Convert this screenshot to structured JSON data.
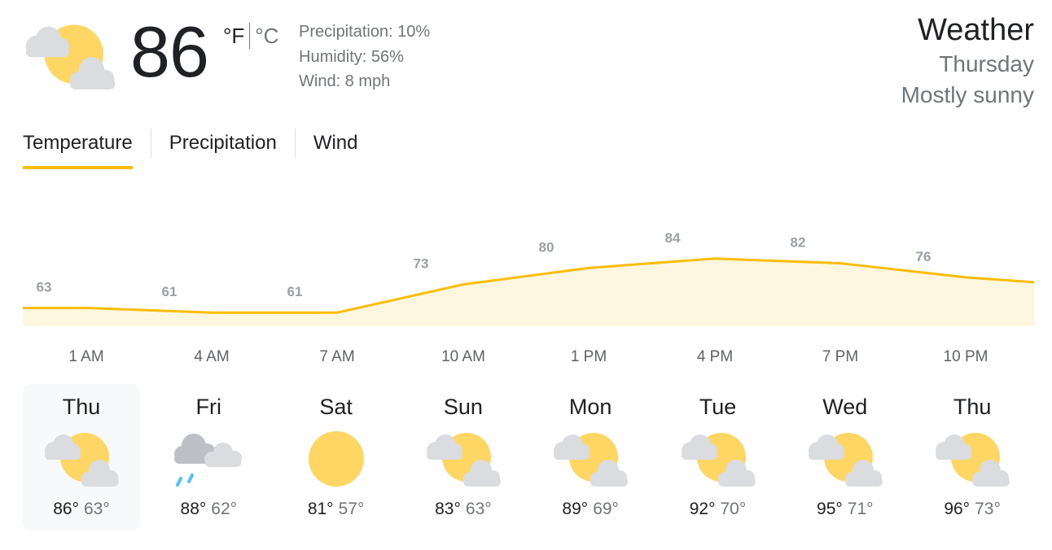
{
  "current": {
    "temperature": "86",
    "unit_f": "°F",
    "unit_c": "°C",
    "icon": "partly-cloudy-icon",
    "precipitation": "Precipitation: 10%",
    "humidity": "Humidity: 56%",
    "wind": "Wind: 8 mph"
  },
  "header": {
    "title": "Weather",
    "day": "Thursday",
    "condition": "Mostly sunny"
  },
  "tabs": [
    {
      "label": "Temperature",
      "active": true
    },
    {
      "label": "Precipitation",
      "active": false
    },
    {
      "label": "Wind",
      "active": false
    }
  ],
  "colors": {
    "accent": "#fbbc04",
    "line": "#fbbc04",
    "fill": "#fef7e0",
    "sun": "#fdd663",
    "cloud": "#dadce0",
    "rain": "#4fc3f7"
  },
  "chart_data": {
    "type": "area",
    "x": [
      "1 AM",
      "4 AM",
      "7 AM",
      "10 AM",
      "1 PM",
      "4 PM",
      "7 PM",
      "10 PM"
    ],
    "values": [
      63,
      61,
      61,
      73,
      80,
      84,
      82,
      76
    ],
    "x_labels": [
      "1 AM",
      "4 AM",
      "7 AM",
      "10 AM",
      "1 PM",
      "4 PM",
      "7 PM",
      "10 PM"
    ],
    "value_labels": [
      "63",
      "61",
      "61",
      "73",
      "80",
      "84",
      "82",
      "76"
    ]
  },
  "forecast": [
    {
      "day": "Thu",
      "icon": "partly-cloudy-icon",
      "high": "86°",
      "low": "63°",
      "selected": true
    },
    {
      "day": "Fri",
      "icon": "rain-icon",
      "high": "88°",
      "low": "62°",
      "selected": false
    },
    {
      "day": "Sat",
      "icon": "sun-icon",
      "high": "81°",
      "low": "57°",
      "selected": false
    },
    {
      "day": "Sun",
      "icon": "partly-cloudy-icon",
      "high": "83°",
      "low": "63°",
      "selected": false
    },
    {
      "day": "Mon",
      "icon": "partly-cloudy-icon",
      "high": "89°",
      "low": "69°",
      "selected": false
    },
    {
      "day": "Tue",
      "icon": "partly-cloudy-icon",
      "high": "92°",
      "low": "70°",
      "selected": false
    },
    {
      "day": "Wed",
      "icon": "partly-cloudy-icon",
      "high": "95°",
      "low": "71°",
      "selected": false
    },
    {
      "day": "Thu",
      "icon": "partly-cloudy-icon",
      "high": "96°",
      "low": "73°",
      "selected": false
    }
  ]
}
